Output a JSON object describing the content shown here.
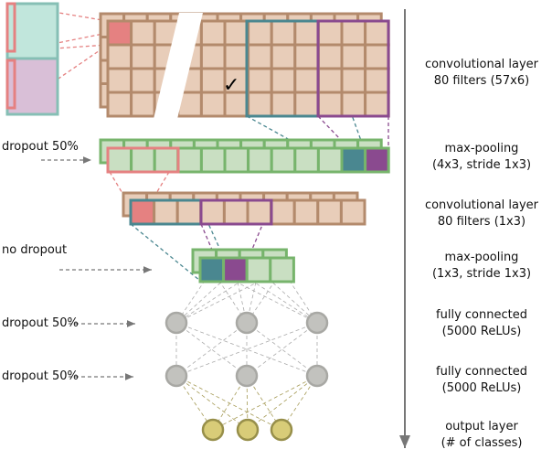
{
  "colors": {
    "conv_fill": "#e8cdb9",
    "conv_stroke": "#b38a6c",
    "pool_fill": "#c9dfc2",
    "pool_stroke": "#77b46c",
    "teal": "#4a8790",
    "purple": "#8a4a8f",
    "pink": "#e58181",
    "input_top": "#c1e6dc",
    "input_bottom": "#d9bfd7",
    "input_border": "#86bfb5",
    "node_fill": "#c2c2be",
    "node_stroke": "#a8a8a4",
    "out_fill": "#d8cc78",
    "out_stroke": "#978f4a",
    "arrow": "#777777"
  },
  "left_labels": [
    {
      "text": "dropout 50%"
    },
    {
      "text": "no dropout"
    },
    {
      "text": "dropout 50%"
    },
    {
      "text": "dropout 50%"
    }
  ],
  "layers": [
    {
      "line1": "convolutional layer",
      "line2": "80 filters (57x6)"
    },
    {
      "line1": "max-pooling",
      "line2": "(4x3, stride 1x3)"
    },
    {
      "line1": "convolutional layer",
      "line2": "80 filters (1x3)"
    },
    {
      "line1": "max-pooling",
      "line2": "(1x3, stride 1x3)"
    },
    {
      "line1": "fully connected",
      "line2": "(5000 ReLUs)"
    },
    {
      "line1": "fully connected",
      "line2": "(5000 ReLUs)"
    },
    {
      "line1": "output layer",
      "line2": "(# of classes)"
    }
  ],
  "checkmark": "✓"
}
